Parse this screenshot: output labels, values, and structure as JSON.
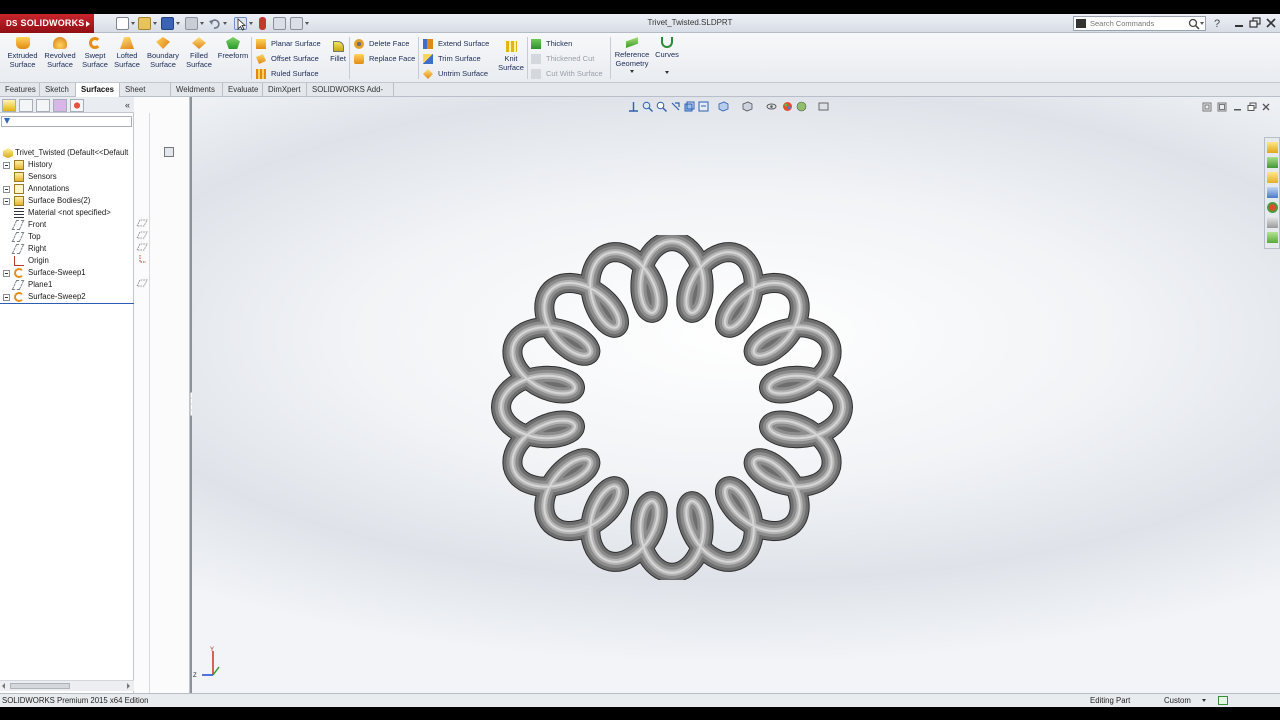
{
  "app": {
    "logo_prefix": "DS",
    "logo_text": "SOLIDWORKS",
    "document_title": "Trivet_Twisted.SLDPRT",
    "search_placeholder": "Search Commands"
  },
  "ribbon": {
    "big_buttons": [
      {
        "line1": "Extruded",
        "line2": "Surface"
      },
      {
        "line1": "Revolved",
        "line2": "Surface"
      },
      {
        "line1": "Swept",
        "line2": "Surface"
      },
      {
        "line1": "Lofted",
        "line2": "Surface"
      },
      {
        "line1": "Boundary",
        "line2": "Surface"
      },
      {
        "line1": "Filled",
        "line2": "Surface"
      },
      {
        "line1": "Freeform",
        "line2": ""
      }
    ],
    "group1": [
      "Planar Surface",
      "Offset Surface",
      "Ruled Surface"
    ],
    "fillet": "Fillet",
    "group2": [
      "Delete Face",
      "Replace Face"
    ],
    "group3": [
      "Extend Surface",
      "Trim Surface",
      "Untrim Surface"
    ],
    "knit": {
      "line1": "Knit",
      "line2": "Surface"
    },
    "group4": [
      "Thicken",
      "Thickened Cut",
      "Cut With Surface"
    ],
    "reference_geometry": {
      "line1": "Reference",
      "line2": "Geometry"
    },
    "curves": "Curves"
  },
  "tabs": [
    {
      "label": "Features",
      "active": false
    },
    {
      "label": "Sketch",
      "active": false
    },
    {
      "label": "Surfaces",
      "active": true
    },
    {
      "label": "Sheet Metal",
      "active": false
    },
    {
      "label": "Weldments",
      "active": false
    },
    {
      "label": "Evaluate",
      "active": false
    },
    {
      "label": "DimXpert",
      "active": false
    },
    {
      "label": "SOLIDWORKS Add-Ins",
      "active": false
    }
  ],
  "feature_tree": {
    "root": "Trivet_Twisted  (Default<<Default",
    "items": [
      {
        "label": "History",
        "icon": "history-folder-icon",
        "expandable": true
      },
      {
        "label": "Sensors",
        "icon": "sensors-folder-icon",
        "expandable": false
      },
      {
        "label": "Annotations",
        "icon": "annotations-icon",
        "expandable": true
      },
      {
        "label": "Surface Bodies(2)",
        "icon": "surface-bodies-icon",
        "expandable": true
      },
      {
        "label": "Material <not specified>",
        "icon": "material-icon",
        "expandable": false
      },
      {
        "label": "Front",
        "icon": "plane-icon",
        "expandable": false
      },
      {
        "label": "Top",
        "icon": "plane-icon",
        "expandable": false
      },
      {
        "label": "Right",
        "icon": "plane-icon",
        "expandable": false
      },
      {
        "label": "Origin",
        "icon": "origin-icon",
        "expandable": false
      },
      {
        "label": "Surface-Sweep1",
        "icon": "surface-sweep-icon",
        "expandable": true
      },
      {
        "label": "Plane1",
        "icon": "plane-icon",
        "expandable": false
      },
      {
        "label": "Surface-Sweep2",
        "icon": "surface-sweep-icon",
        "expandable": true
      }
    ]
  },
  "triad": {
    "y_label": "Y",
    "z_label": "Z"
  },
  "status": {
    "edition": "SOLIDWORKS Premium 2015 x64 Edition",
    "mode": "Editing Part",
    "units": "Custom"
  },
  "colors": {
    "brand_red": "#b71c22",
    "ribbon_text": "#1a2a55",
    "part_gray": "#8a8a8a"
  }
}
